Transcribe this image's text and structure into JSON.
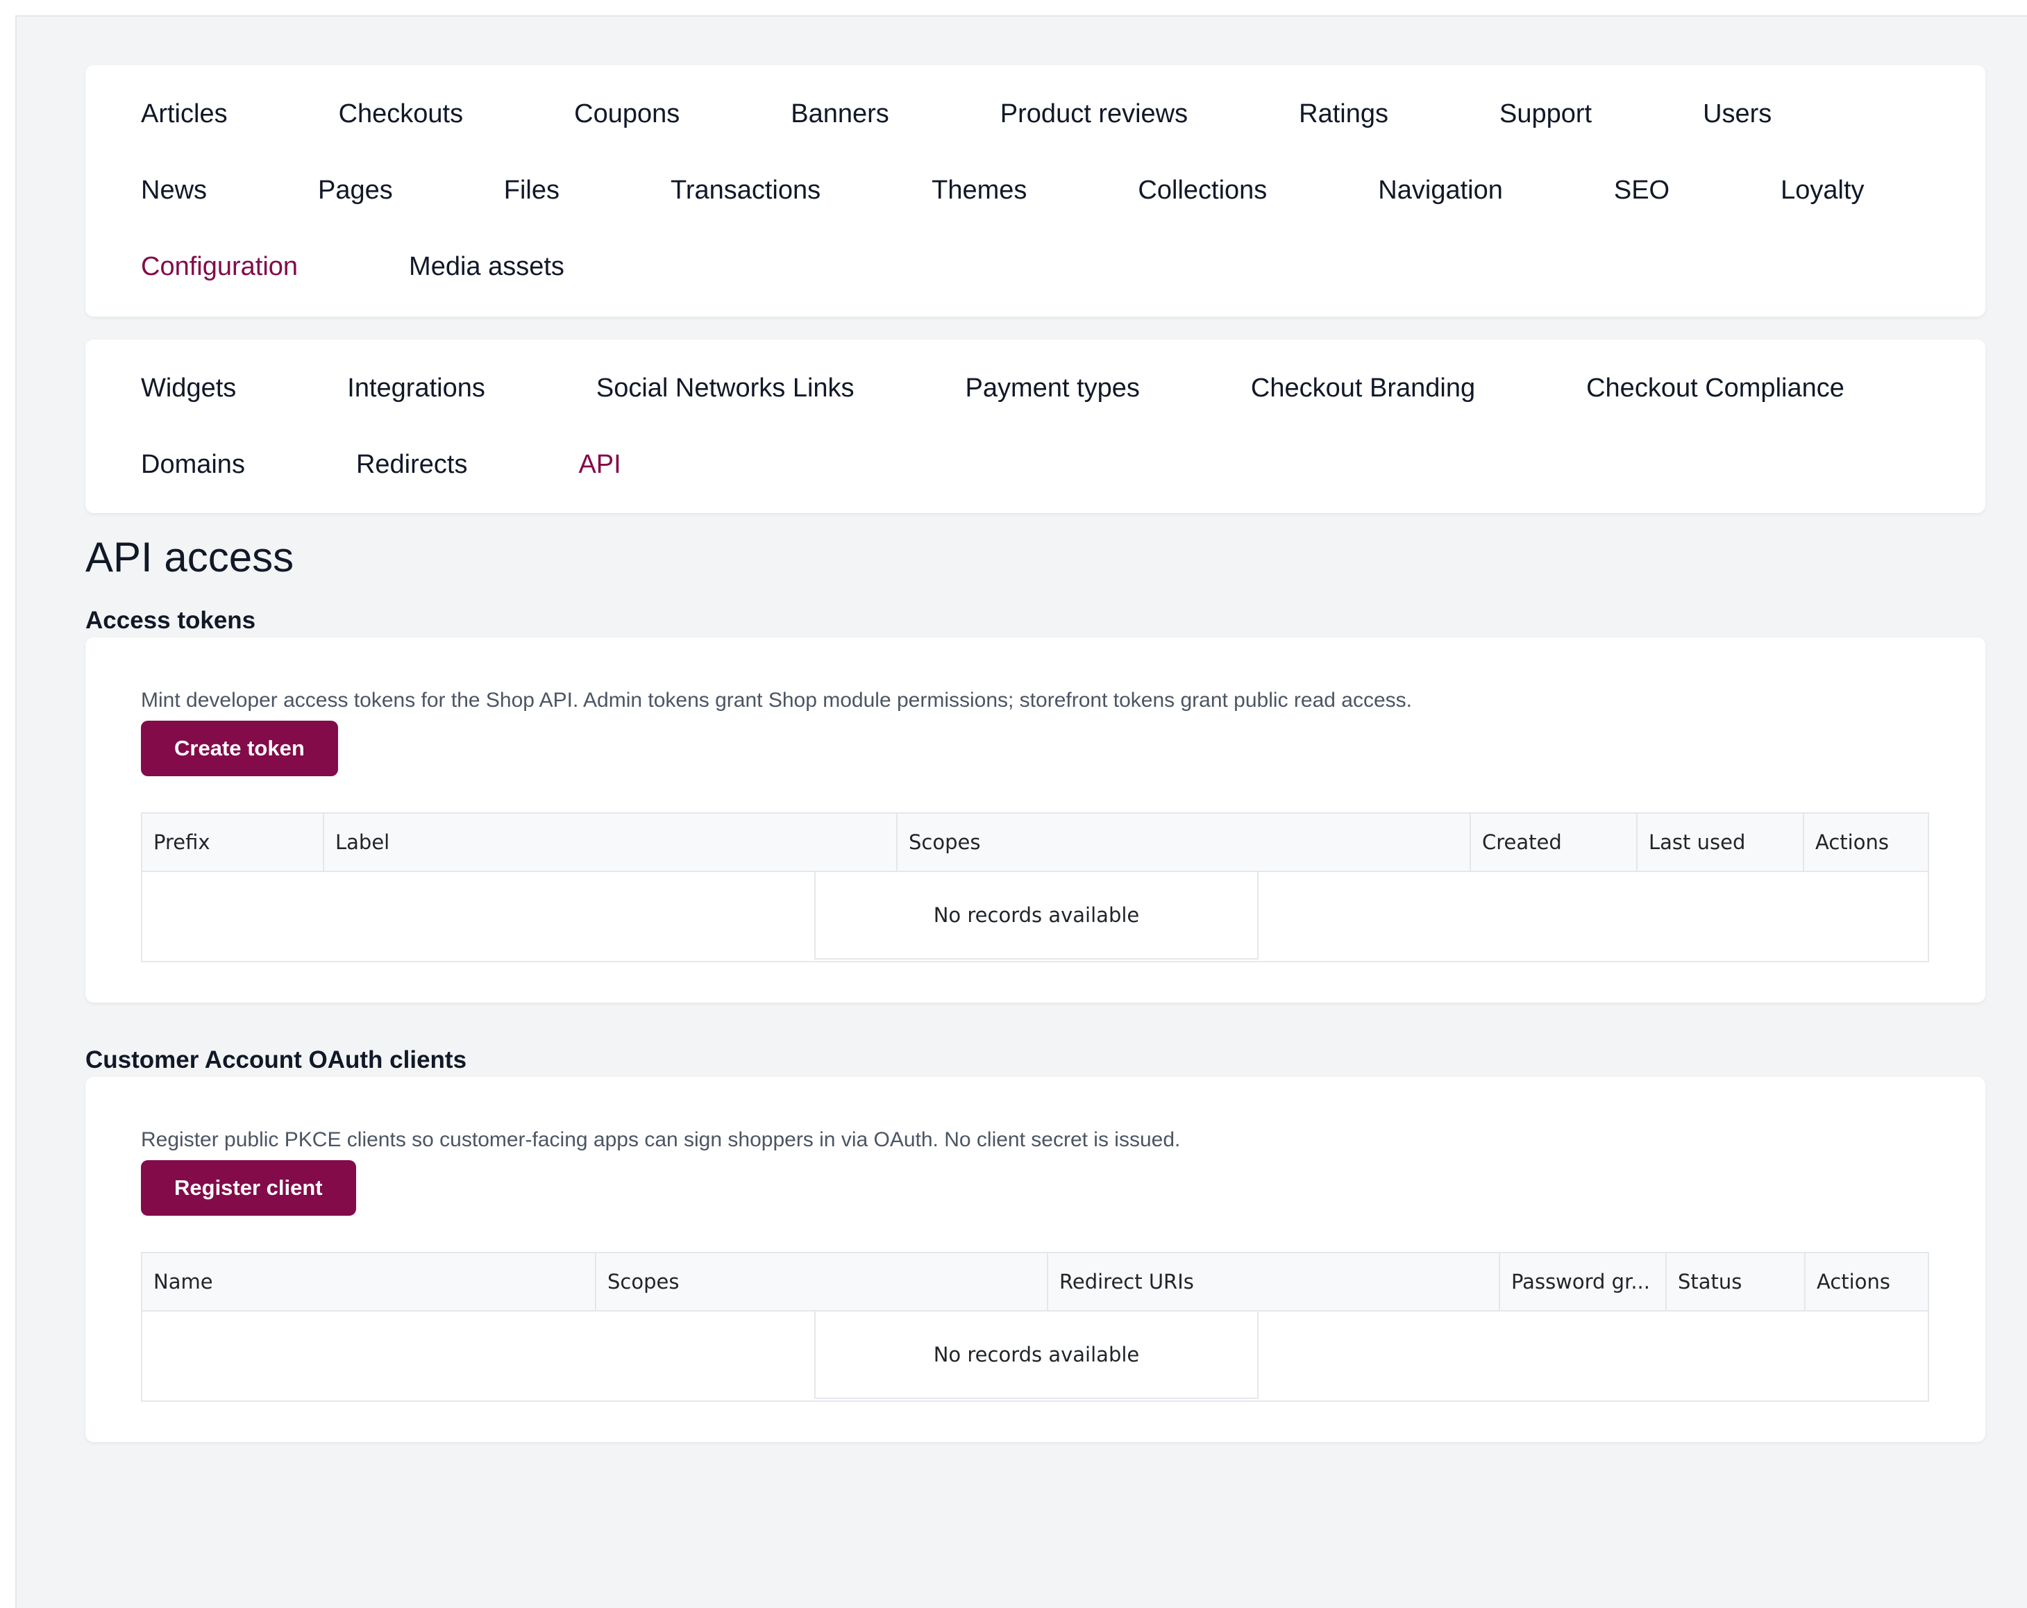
{
  "primary_nav": {
    "rows": [
      [
        {
          "label": "Articles"
        },
        {
          "label": "Checkouts"
        },
        {
          "label": "Coupons"
        },
        {
          "label": "Banners"
        },
        {
          "label": "Product reviews"
        },
        {
          "label": "Ratings"
        },
        {
          "label": "Support"
        },
        {
          "label": "Users"
        }
      ],
      [
        {
          "label": "News"
        },
        {
          "label": "Pages"
        },
        {
          "label": "Files"
        },
        {
          "label": "Transactions"
        },
        {
          "label": "Themes"
        },
        {
          "label": "Collections"
        },
        {
          "label": "Navigation"
        },
        {
          "label": "SEO"
        },
        {
          "label": "Loyalty"
        }
      ],
      [
        {
          "label": "Configuration",
          "active": true
        },
        {
          "label": "Media assets"
        }
      ]
    ]
  },
  "secondary_nav": {
    "rows": [
      [
        {
          "label": "Widgets"
        },
        {
          "label": "Integrations"
        },
        {
          "label": "Social Networks Links"
        },
        {
          "label": "Payment types"
        },
        {
          "label": "Checkout Branding"
        },
        {
          "label": "Checkout Compliance"
        }
      ],
      [
        {
          "label": "Domains"
        },
        {
          "label": "Redirects"
        },
        {
          "label": "API",
          "active": true
        }
      ]
    ]
  },
  "page": {
    "title": "API access"
  },
  "access_tokens": {
    "title": "Access tokens",
    "description": "Mint developer access tokens for the Shop API. Admin tokens grant Shop module permissions; storefront tokens grant public read access.",
    "button_label": "Create token",
    "columns": [
      "Prefix",
      "Label",
      "Scopes",
      "Created",
      "Last used",
      "Actions"
    ],
    "empty_text": "No records available"
  },
  "oauth_clients": {
    "title": "Customer Account OAuth clients",
    "description": "Register public PKCE clients so customer-facing apps can sign shoppers in via OAuth. No client secret is issued.",
    "button_label": "Register client",
    "columns": [
      "Name",
      "Scopes",
      "Redirect URIs",
      "Password gr...",
      "Status",
      "Actions"
    ],
    "empty_text": "No records available"
  },
  "colors": {
    "accent": "#830b49",
    "page_background": "#f3f4f6",
    "card_background": "#ffffff",
    "text": "#111827",
    "muted_text": "#4b5563",
    "grid_border": "#e5e7eb",
    "grid_header_background": "#f8f9fa"
  }
}
